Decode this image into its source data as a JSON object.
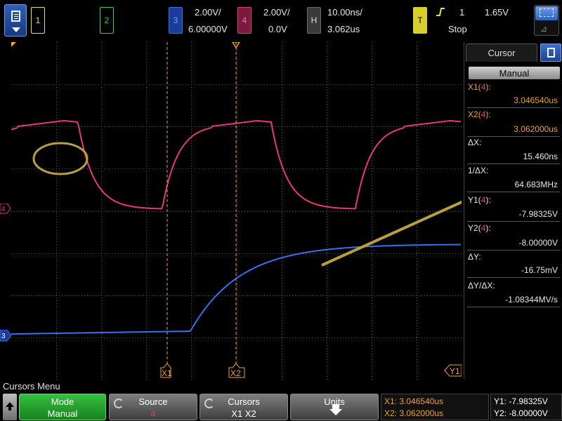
{
  "topbar": {
    "ch1_label": "1",
    "ch2_label": "2",
    "ch3": {
      "label": "3",
      "scale": "2.00V/",
      "offset": "6.00000V"
    },
    "ch4": {
      "label": "4",
      "scale": "2.00V/",
      "offset": "0.0V"
    },
    "horizontal": {
      "label": "H",
      "scale": "10.00ns/",
      "delay": "3.062us"
    },
    "trigger": {
      "label": "T",
      "source": "1",
      "level": "1.65V",
      "status": "Stop",
      "edge_icon": "rising-edge-icon"
    }
  },
  "colors": {
    "ch1": "#e6e62e",
    "ch2": "#3fcf3f",
    "ch3": "#3a6ff0",
    "ch4": "#e8377a",
    "cursor": "#f0a030",
    "annotation": "#b8a040"
  },
  "grid_markers": {
    "ch4_marker": "4",
    "ch3_marker": "3",
    "x1_tag": "X1",
    "x2_tag": "X2",
    "y1_tag": "Y1"
  },
  "panel": {
    "title": "Cursor",
    "mode_button": "Manual",
    "x1": {
      "label_a": "X1(",
      "label_ch": "4",
      "label_b": "):",
      "value": "3.046540us"
    },
    "x2": {
      "label_a": "X2(",
      "label_ch": "4",
      "label_b": "):",
      "value": "3.062000us"
    },
    "dx": {
      "label": "ΔX:",
      "value": "15.460ns"
    },
    "inv_dx": {
      "label": "1/ΔX:",
      "value": "64.683MHz"
    },
    "y1": {
      "label_a": "Y1(",
      "label_ch": "4",
      "label_b": "):",
      "value": "-7.98325V"
    },
    "y2": {
      "label_a": "Y2(",
      "label_ch": "4",
      "label_b": "):",
      "value": "-8.00000V"
    },
    "dy": {
      "label": "ΔY:",
      "value": "-16.75mV"
    },
    "dydx": {
      "label": "ΔY/ΔX:",
      "value": "-1.08344MV/s"
    }
  },
  "bottom": {
    "menu_title": "Cursors Menu",
    "mode": {
      "label": "Mode",
      "value": "Manual"
    },
    "source": {
      "label": "Source",
      "value": "4"
    },
    "cursors": {
      "label": "Cursors",
      "value": "X1 X2"
    },
    "units": {
      "label": "Units"
    },
    "readout_x": {
      "x1_label": "X1:",
      "x1_value": "3.046540us",
      "x2_label": "X2:",
      "x2_value": "3.062000us"
    },
    "readout_y": {
      "y1": "Y1: -7.98325V",
      "y2": "Y2: -8.00000V"
    }
  }
}
